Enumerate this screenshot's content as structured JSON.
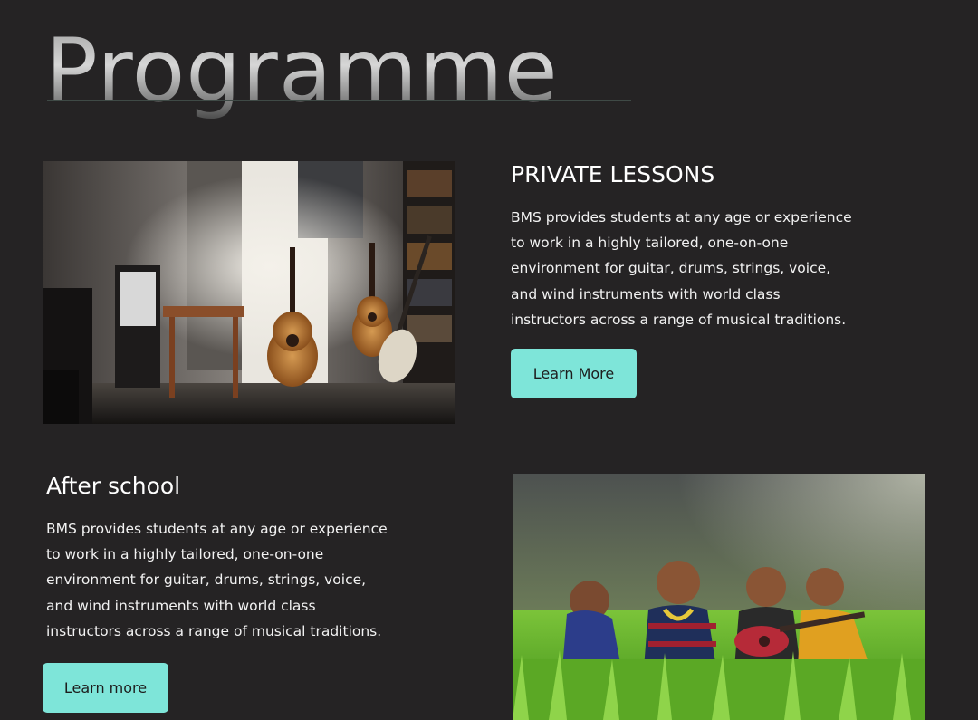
{
  "page": {
    "title": "Programme"
  },
  "sections": {
    "private": {
      "heading": "PRIVATE LESSONS",
      "body": "BMS provides students at any age or experience to work in a highly tailored, one-on-one environment for guitar, drums, strings, voice, and wind instruments with world class instructors across a range of musical traditions.",
      "button_label": "Learn More"
    },
    "after_school": {
      "heading": "After school",
      "body": "BMS provides students at any age or experience to work in a highly tailored, one-on-one environment for guitar, drums, strings, voice, and wind instruments with world class instructors across a range of musical traditions.",
      "button_label": "Learn more"
    }
  },
  "colors": {
    "background": "#252324",
    "button": "#7ee5d9",
    "button_text": "#1d1d1d",
    "text": "#ffffff"
  }
}
